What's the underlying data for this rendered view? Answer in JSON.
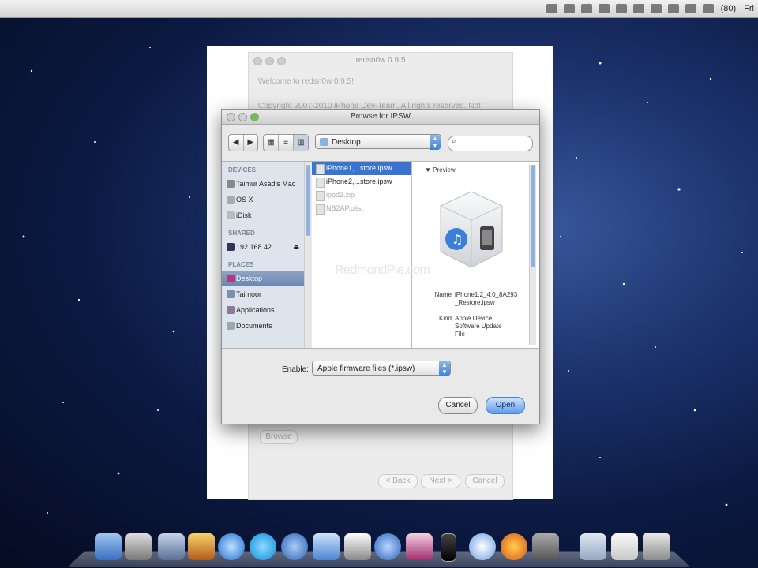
{
  "menubar": {
    "time": "Fri",
    "status_text": "(80)"
  },
  "background_window": {
    "title": "redsn0w 0.9.5",
    "welcome": "Welcome to redsn0w 0.9.5!",
    "copyright": "Copyright 2007-2010 iPhone Dev-Team. All rights reserved. Not",
    "browse_label": "Browse",
    "back_label": "< Back",
    "next_label": "Next >",
    "cancel_label": "Cancel"
  },
  "dialog": {
    "title": "Browse for IPSW",
    "location": "Desktop",
    "search_placeholder": "",
    "sidebar": {
      "devices_header": "DEVICES",
      "devices": [
        "Taimur Asad's Mac",
        "OS X",
        "iDisk"
      ],
      "shared_header": "SHARED",
      "shared": [
        "192.168.42"
      ],
      "places_header": "PLACES",
      "places": [
        "Desktop",
        "Taimoor",
        "Applications",
        "Documents"
      ]
    },
    "files": [
      {
        "name": "iPhone1,...store.ipsw",
        "selected": true,
        "dim": false
      },
      {
        "name": "iPhone2,...store.ipsw",
        "selected": false,
        "dim": false
      },
      {
        "name": "ipod3.zip",
        "selected": false,
        "dim": true
      },
      {
        "name": "NB2AP.plist",
        "selected": false,
        "dim": true
      }
    ],
    "preview": {
      "header": "Preview",
      "name_label": "Name",
      "name_value": "iPhone1,2_4.0_8A293_Restore.ipsw",
      "kind_label": "Kind",
      "kind_value": "Apple Device Software Update File"
    },
    "enable_label": "Enable:",
    "enable_value": "Apple firmware files (*.ipsw)",
    "cancel_label": "Cancel",
    "open_label": "Open"
  },
  "watermark": "RedmondPie.com",
  "dock": {
    "icons": [
      "finder-icon",
      "dashboard-icon",
      "preview-icon",
      "photo-icon",
      "itunes-icon",
      "skype-icon",
      "safari-icon",
      "folder-icon",
      "home-icon",
      "itunes-app-icon",
      "photo-booth-icon",
      "iphone-icon",
      "compass-icon",
      "firefox-icon",
      "finder-util-icon",
      "folder-stack-icon",
      "document-stack-icon",
      "trash-icon"
    ]
  },
  "colors": {
    "selection": "#3b73d0",
    "open_button": "#5e9bea",
    "sidebar": "#dde4ec",
    "desktop": "#0c1a42"
  }
}
